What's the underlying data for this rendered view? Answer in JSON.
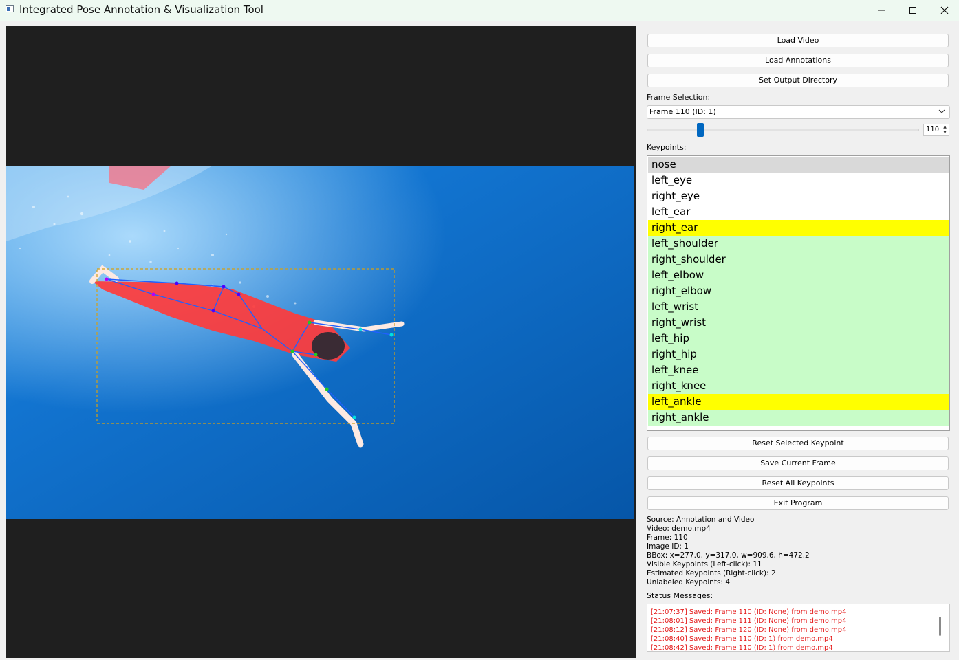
{
  "window": {
    "title": "Integrated Pose Annotation & Visualization Tool",
    "icon": "app-window-icon",
    "controls": [
      "minimize-icon",
      "maximize-icon",
      "close-icon"
    ]
  },
  "sidebar": {
    "load_video": "Load Video",
    "load_annotations": "Load Annotations",
    "set_output_dir": "Set Output Directory",
    "frame_selection_label": "Frame Selection:",
    "frame_combo_value": "Frame 110 (ID: 1)",
    "frame_slider_value": 0.17,
    "frame_spin_value": "110",
    "keypoints_label": "Keypoints:",
    "keypoints": [
      {
        "name": "nose",
        "state": "selected"
      },
      {
        "name": "left_eye",
        "state": "unlabeled"
      },
      {
        "name": "right_eye",
        "state": "unlabeled"
      },
      {
        "name": "left_ear",
        "state": "unlabeled"
      },
      {
        "name": "right_ear",
        "state": "estimated"
      },
      {
        "name": "left_shoulder",
        "state": "visible"
      },
      {
        "name": "right_shoulder",
        "state": "visible"
      },
      {
        "name": "left_elbow",
        "state": "visible"
      },
      {
        "name": "right_elbow",
        "state": "visible"
      },
      {
        "name": "left_wrist",
        "state": "visible"
      },
      {
        "name": "right_wrist",
        "state": "visible"
      },
      {
        "name": "left_hip",
        "state": "visible"
      },
      {
        "name": "right_hip",
        "state": "visible"
      },
      {
        "name": "left_knee",
        "state": "visible"
      },
      {
        "name": "right_knee",
        "state": "visible"
      },
      {
        "name": "left_ankle",
        "state": "estimated"
      },
      {
        "name": "right_ankle",
        "state": "visible"
      }
    ],
    "reset_selected": "Reset Selected Keypoint",
    "save_current": "Save Current Frame",
    "reset_all": "Reset All Keypoints",
    "exit_program": "Exit Program",
    "info": {
      "source": "Source: Annotation and Video",
      "video": "Video: demo.mp4",
      "frame": "Frame: 110",
      "image_id": "Image ID: 1",
      "bbox": "BBox: x=277.0, y=317.0, w=909.6, h=472.2",
      "visible": "Visible Keypoints (Left-click): 11",
      "estimated": "Estimated Keypoints (Right-click): 2",
      "unlabeled": "Unlabeled Keypoints: 4"
    },
    "status_label": "Status Messages:",
    "status_messages": [
      "[21:07:37] Saved: Frame 110 (ID: None) from demo.mp4",
      "[21:08:01] Saved: Frame 111 (ID: None) from demo.mp4",
      "[21:08:12] Saved: Frame 120 (ID: None) from demo.mp4",
      "[21:08:40] Saved: Frame 110 (ID: 1) from demo.mp4",
      "[21:08:42] Saved: Frame 110 (ID: 1) from demo.mp4"
    ]
  },
  "colors": {
    "visible_keypoint_bg": "#c8fcc8",
    "estimated_keypoint_bg": "#ffff00",
    "selected_keypoint_bg": "#d9d9d9",
    "status_text": "#e41a1a",
    "bbox": "#d4a017",
    "skeleton": "#2060ff",
    "water": "#0d6fc8"
  }
}
